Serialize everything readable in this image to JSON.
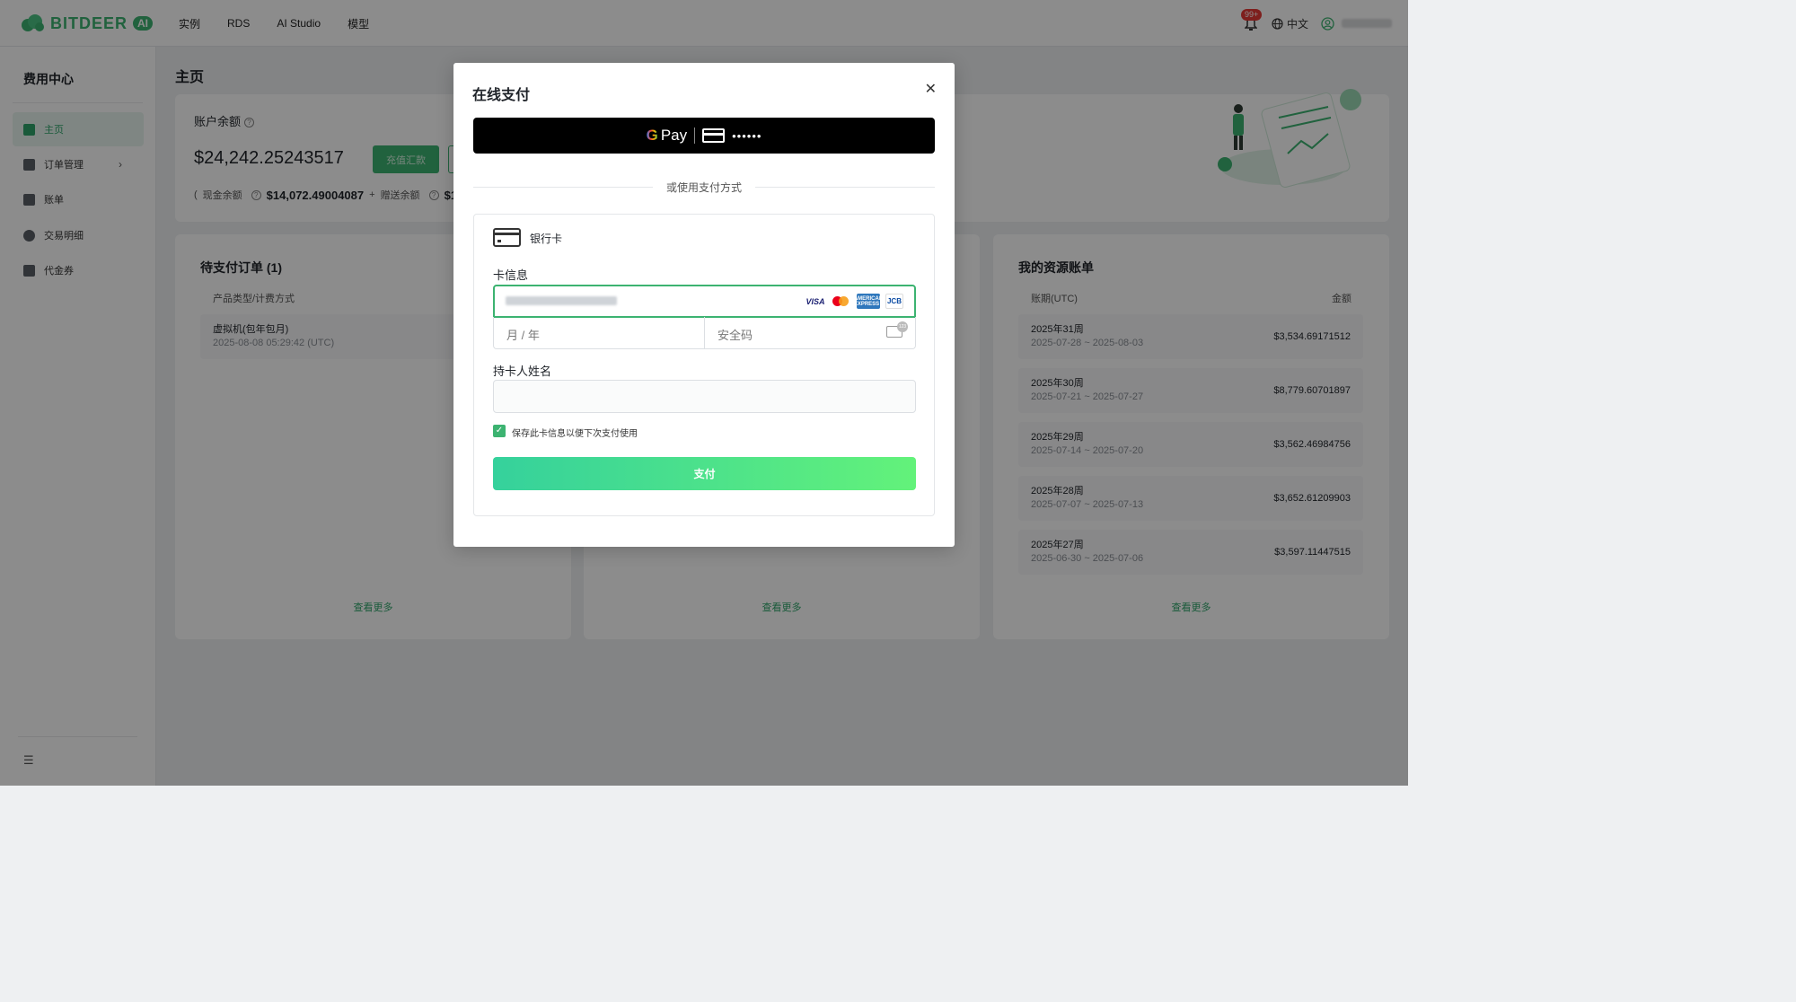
{
  "topnav": {
    "logo_text": "BITDEER",
    "logo_badge": "AI",
    "links": [
      "实例",
      "RDS",
      "AI Studio",
      "模型"
    ],
    "notification_count": "99+",
    "language": "中文"
  },
  "sidebar": {
    "title": "费用中心",
    "items": [
      {
        "label": "主页",
        "icon": "home-icon",
        "active": true
      },
      {
        "label": "订单管理",
        "icon": "order-icon",
        "active": false
      },
      {
        "label": "账单",
        "icon": "bill-icon",
        "active": false
      },
      {
        "label": "交易明细",
        "icon": "transaction-icon",
        "active": false
      },
      {
        "label": "代金券",
        "icon": "voucher-icon",
        "active": false
      }
    ]
  },
  "main": {
    "page_title": "主页",
    "account": {
      "label": "账户余额",
      "balance": "$24,242.25243517",
      "recharge_label": "充值汇款",
      "paren_open": "(",
      "cash_label": "现金余额",
      "cash_value": "$14,072.49004087",
      "plus": "+",
      "gift_label": "赠送余额",
      "gift_value_partial": "$1"
    },
    "pending": {
      "title": "待支付订单 (1)",
      "col_header": "产品类型/计费方式",
      "rows": [
        {
          "title": "虚拟机(包年包月)",
          "subtitle": "2025-08-08 05:29:42 (UTC)"
        }
      ],
      "more": "查看更多"
    },
    "middle": {
      "more": "查看更多"
    },
    "resources": {
      "title": "我的资源账单",
      "col_period": "账期(UTC)",
      "col_amount": "金额",
      "rows": [
        {
          "week": "2025年31周",
          "range": "2025-07-28 ~ 2025-08-03",
          "amount": "$3,534.69171512"
        },
        {
          "week": "2025年30周",
          "range": "2025-07-21 ~ 2025-07-27",
          "amount": "$8,779.60701897"
        },
        {
          "week": "2025年29周",
          "range": "2025-07-14 ~ 2025-07-20",
          "amount": "$3,562.46984756"
        },
        {
          "week": "2025年28周",
          "range": "2025-07-07 ~ 2025-07-13",
          "amount": "$3,652.61209903"
        },
        {
          "week": "2025年27周",
          "range": "2025-06-30 ~ 2025-07-06",
          "amount": "$3,597.11447515"
        }
      ],
      "more": "查看更多"
    }
  },
  "modal": {
    "title": "在线支付",
    "gpay_g": "G",
    "gpay_pay": "Pay",
    "gpay_dots": "••••••",
    "or_text": "或使用支付方式",
    "bank_card_label": "银行卡",
    "card_info_label": "卡信息",
    "brands": [
      "VISA",
      "AMERICAN EXPRESS",
      "JCB"
    ],
    "expiry_placeholder": "月 / 年",
    "cvc_placeholder": "安全码",
    "cvc_hint": "123",
    "holder_label": "持卡人姓名",
    "holder_value": "",
    "save_card_label": "保存此卡信息以便下次支付使用",
    "save_card_checked": true,
    "pay_label": "支付"
  },
  "colors": {
    "accent": "#3cb371",
    "overlay": "rgba(0,0,0,0.45)",
    "pay_gradient_start": "#35d19c",
    "pay_gradient_end": "#63f27a",
    "badge": "#e53935"
  }
}
